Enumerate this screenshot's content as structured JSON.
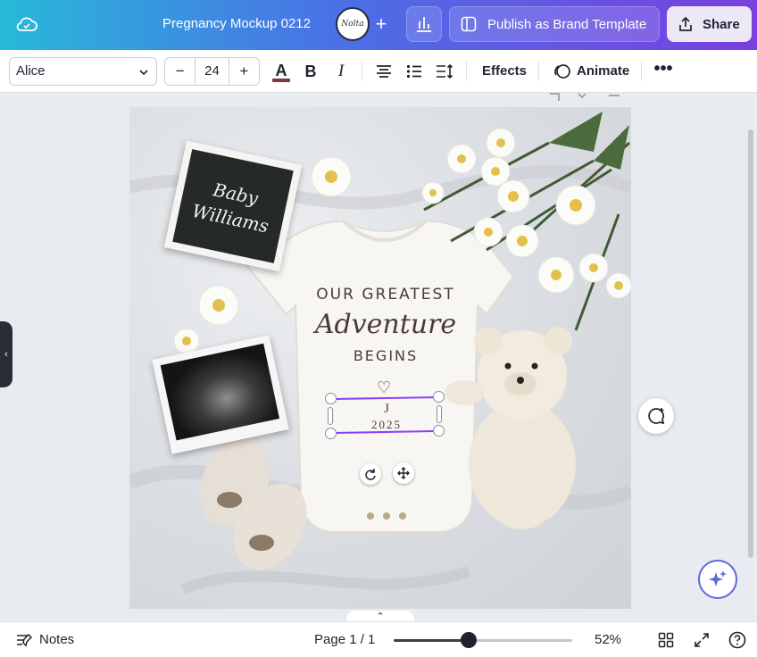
{
  "header": {
    "doc_title": "Pregnancy Mockup 0212",
    "avatar_text": "Nolta",
    "publish_label": "Publish as Brand Template",
    "share_label": "Share"
  },
  "toolbar": {
    "font_name": "Alice",
    "font_size": "24",
    "minus": "−",
    "plus": "+",
    "text_color_glyph": "A",
    "bold_glyph": "B",
    "italic_glyph": "I",
    "effects_label": "Effects",
    "animate_label": "Animate",
    "more_glyph": "•••",
    "text_color": "#7d3a3a"
  },
  "canvas": {
    "letterboard_line1": "Baby",
    "letterboard_line2": "Williams",
    "onesie_line1": "OUR GREATEST",
    "onesie_line2": "Adventure",
    "onesie_line3": "BEGINS",
    "heart_glyph": "♡",
    "name_text": "J",
    "year_text": "2025",
    "selection_color": "#8b3dff"
  },
  "footer": {
    "notes_label": "Notes",
    "page_indicator": "Page 1 / 1",
    "zoom_value": "52%",
    "zoom_fraction": 0.42,
    "pages_chevron": "⌃"
  },
  "side_tab_glyph": "‹",
  "icons": [
    "cloud-icon",
    "add-icon",
    "insights-icon",
    "publish-template-icon",
    "share-icon",
    "chevron-down-icon",
    "align-center-icon",
    "bullet-list-icon",
    "line-spacing-icon",
    "animate-icon",
    "rotate-icon",
    "move-icon",
    "add-comment-icon",
    "magic-sparkle-icon",
    "notes-icon",
    "grid-view-icon",
    "fullscreen-icon",
    "help-icon"
  ]
}
